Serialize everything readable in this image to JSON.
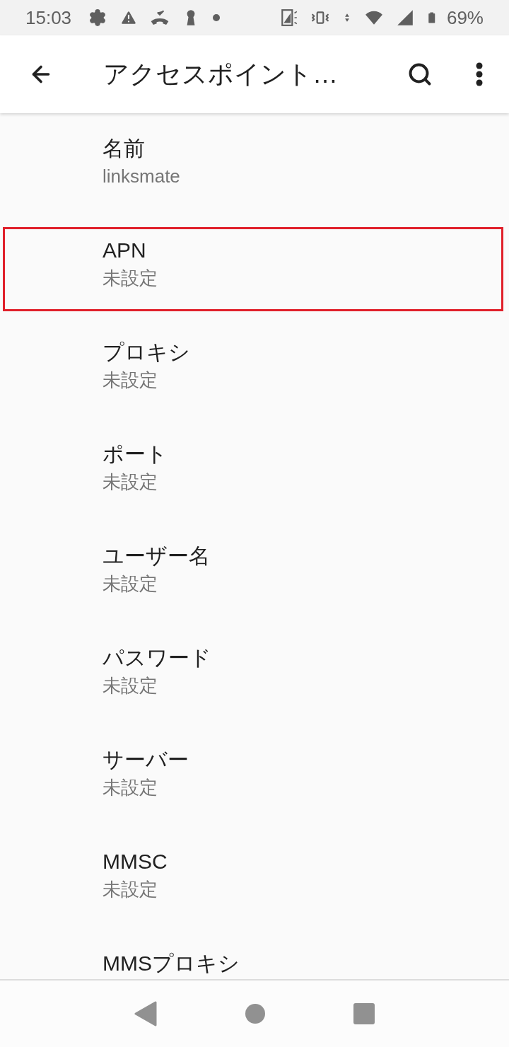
{
  "status_bar": {
    "time": "15:03",
    "battery": "69%"
  },
  "app_bar": {
    "title": "アクセスポイント…"
  },
  "fields": [
    {
      "title": "名前",
      "value": "linksmate",
      "highlighted": false
    },
    {
      "title": "APN",
      "value": "未設定",
      "highlighted": true
    },
    {
      "title": "プロキシ",
      "value": "未設定",
      "highlighted": false
    },
    {
      "title": "ポート",
      "value": "未設定",
      "highlighted": false
    },
    {
      "title": "ユーザー名",
      "value": "未設定",
      "highlighted": false
    },
    {
      "title": "パスワード",
      "value": "未設定",
      "highlighted": false
    },
    {
      "title": "サーバー",
      "value": "未設定",
      "highlighted": false
    },
    {
      "title": "MMSC",
      "value": "未設定",
      "highlighted": false
    },
    {
      "title": "MMSプロキシ",
      "highlighted": false
    }
  ]
}
